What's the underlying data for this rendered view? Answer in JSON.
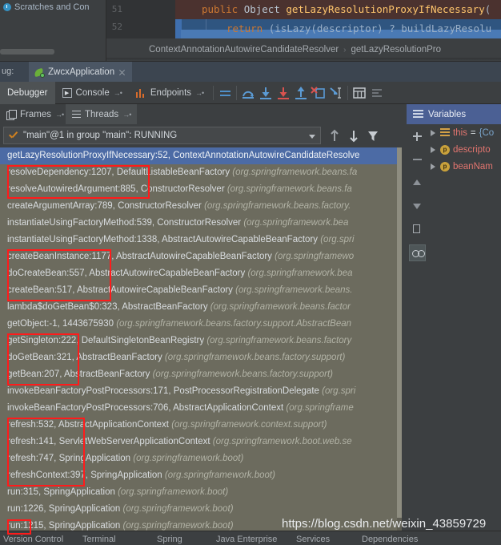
{
  "project_panel": {
    "item_label": "Scratches and Con"
  },
  "editor": {
    "lines": [
      {
        "number": "51",
        "segments": [
          {
            "t": "public ",
            "c": "kw"
          },
          {
            "t": "Object ",
            "c": "typ"
          },
          {
            "t": "getLazyResolutionProxyIfNecessary",
            "c": "mth"
          },
          {
            "t": "(",
            "c": "pln"
          }
        ]
      },
      {
        "number": "52",
        "segments": [
          {
            "t": "return ",
            "c": "kw"
          },
          {
            "t": "(isLazy(descriptor) ? buildLazyResolu",
            "c": "dim"
          }
        ]
      }
    ],
    "breadcrumb": [
      "ContextAnnotationAutowireCandidateResolver",
      "getLazyResolutionPro"
    ],
    "breadcrumb_separator": "›"
  },
  "run_bar": {
    "label": "ug:",
    "tab_name": "ZwcxApplication",
    "close_title": "Close",
    "leaf_icon": "spring-leaf-icon"
  },
  "debug_toolbar": {
    "tabs": [
      {
        "name": "Debugger",
        "pin": "",
        "icon": ""
      },
      {
        "name": "Console",
        "pin": "→•",
        "icon": "console-icon"
      },
      {
        "name": "Endpoints",
        "pin": "→•",
        "icon": "endpoints-icon"
      }
    ],
    "actions": [
      "show-execution-point-icon",
      "step-over-icon",
      "step-into-icon",
      "force-step-into-icon",
      "step-out-icon",
      "drop-frame-icon",
      "run-to-cursor-icon",
      "evaluate-expression-icon",
      "mute-breakpoints-icon"
    ]
  },
  "panels": {
    "frames_tab": "Frames",
    "frames_pin": "→•",
    "threads_tab": "Threads",
    "threads_pin": "→•",
    "variables_title": "Variables"
  },
  "thread_selector": {
    "value": "\"main\"@1 in group \"main\": RUNNING",
    "status_icon": "checkmark-icon",
    "buttons": [
      "up-arrow-icon",
      "down-arrow-icon",
      "filter-icon"
    ]
  },
  "frames": [
    {
      "text": "getLazyResolutionProxyIfNecessary:52, ContextAnnotationAutowireCandidateResolve",
      "pkg": "",
      "selected": true
    },
    {
      "text": "resolveDependency:1207, DefaultListableBeanFactory",
      "pkg": "(org.springframework.beans.fa",
      "selected": false
    },
    {
      "text": "resolveAutowiredArgument:885, ConstructorResolver",
      "pkg": "(org.springframework.beans.fa",
      "selected": false
    },
    {
      "text": "createArgumentArray:789, ConstructorResolver",
      "pkg": "(org.springframework.beans.factory.",
      "selected": false
    },
    {
      "text": "instantiateUsingFactoryMethod:539, ConstructorResolver",
      "pkg": "(org.springframework.bea",
      "selected": false
    },
    {
      "text": "instantiateUsingFactoryMethod:1338, AbstractAutowireCapableBeanFactory",
      "pkg": "(org.spri",
      "selected": false
    },
    {
      "text": "createBeanInstance:1177, AbstractAutowireCapableBeanFactory",
      "pkg": "(org.springframewo",
      "selected": false
    },
    {
      "text": "doCreateBean:557, AbstractAutowireCapableBeanFactory",
      "pkg": "(org.springframework.bea",
      "selected": false
    },
    {
      "text": "createBean:517, AbstractAutowireCapableBeanFactory",
      "pkg": "(org.springframework.beans.",
      "selected": false
    },
    {
      "text": "lambda$doGetBean$0:323, AbstractBeanFactory",
      "pkg": "(org.springframework.beans.factor",
      "selected": false
    },
    {
      "text": "getObject:-1, 1443675930",
      "pkg": "(org.springframework.beans.factory.support.AbstractBean",
      "selected": false
    },
    {
      "text": "getSingleton:222, DefaultSingletonBeanRegistry",
      "pkg": "(org.springframework.beans.factory",
      "selected": false
    },
    {
      "text": "doGetBean:321, AbstractBeanFactory",
      "pkg": "(org.springframework.beans.factory.support)",
      "selected": false
    },
    {
      "text": "getBean:207, AbstractBeanFactory",
      "pkg": "(org.springframework.beans.factory.support)",
      "selected": false
    },
    {
      "text": "invokeBeanFactoryPostProcessors:171, PostProcessorRegistrationDelegate",
      "pkg": "(org.spri",
      "selected": false
    },
    {
      "text": "invokeBeanFactoryPostProcessors:706, AbstractApplicationContext",
      "pkg": "(org.springframe",
      "selected": false
    },
    {
      "text": "refresh:532, AbstractApplicationContext",
      "pkg": "(org.springframework.context.support)",
      "selected": false
    },
    {
      "text": "refresh:141, ServletWebServerApplicationContext",
      "pkg": "(org.springframework.boot.web.se",
      "selected": false
    },
    {
      "text": "refresh:747, SpringApplication",
      "pkg": "(org.springframework.boot)",
      "selected": false
    },
    {
      "text": "refreshContext:397, SpringApplication",
      "pkg": "(org.springframework.boot)",
      "selected": false
    },
    {
      "text": "run:315, SpringApplication",
      "pkg": "(org.springframework.boot)",
      "selected": false
    },
    {
      "text": "run:1226, SpringApplication",
      "pkg": "(org.springframework.boot)",
      "selected": false
    },
    {
      "text": "run:1215, SpringApplication",
      "pkg": "(org.springframework.boot)",
      "selected": false
    }
  ],
  "variables_toolbar": [
    "add-watch-icon",
    "remove-watch-icon",
    "move-up-icon",
    "move-down-icon",
    "copy-value-icon",
    "watches-icon"
  ],
  "variables": [
    {
      "icon": "field-icon",
      "name": "this",
      "eq": " = ",
      "value": "{Co"
    },
    {
      "icon": "parameter-icon",
      "name": "descripto",
      "eq": "",
      "value": ""
    },
    {
      "icon": "parameter-icon",
      "name": "beanNam",
      "eq": "",
      "value": ""
    }
  ],
  "watermark": "https://blog.csdn.net/weixin_43859729",
  "bottom_bar": [
    "Version Control",
    "Terminal",
    "Spring",
    "Java Enterprise",
    "Services",
    "Dependencies"
  ],
  "colors": {
    "frames_bg": "#6c6b5e",
    "selection_blue": "#4c6ba5",
    "annotation_red": "#ff1b1b",
    "variables_header": "#4b6094",
    "line51_bg": "#4b322f",
    "line52_bg": "#2f5580"
  }
}
